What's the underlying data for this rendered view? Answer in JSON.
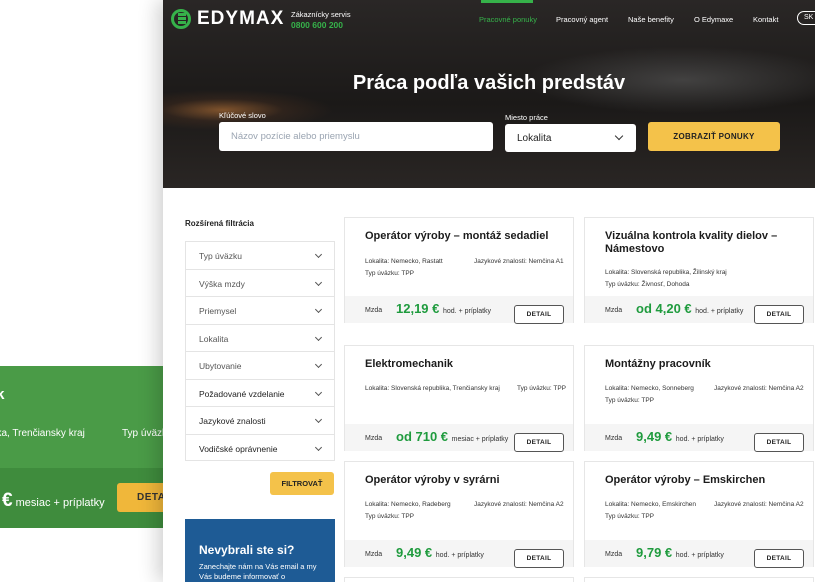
{
  "header": {
    "logo_text": "EDYMAX",
    "service_label": "Zákaznícky servis",
    "service_phone": "0800 600 200",
    "nav": [
      "Pracovné ponuky",
      "Pracovný agent",
      "Naše benefity",
      "O Edymaxe",
      "Kontakt"
    ],
    "lang": "SK",
    "accent_color": "#36b24a"
  },
  "hero": {
    "title": "Práca podľa vašich predstáv",
    "keyword_label": "Kľúčové slovo",
    "keyword_placeholder": "Názov pozície alebo priemyslu",
    "location_label": "Miesto práce",
    "location_value": "Lokalita",
    "search_button": "ZOBRAZIŤ PONUKY"
  },
  "filters": {
    "title": "Rozšírená filtrácia",
    "items": [
      "Typ úväzku",
      "Výška mzdy",
      "Priemysel",
      "Lokalita",
      "Ubytovanie",
      "Požadované vzdelanie",
      "Jazykové znalosti",
      "Vodičské oprávnenie"
    ],
    "button": "FILTROVAŤ"
  },
  "promo": {
    "heading": "Nevybrali ste si?",
    "text": "Zanechajte nám na Vás email a my Vás budeme informovať o"
  },
  "jobs": [
    {
      "title": "Operátor výroby – montáž sedadiel",
      "location": "Lokalita: Nemecko, Rastatt",
      "language": "Jazykové znalosti: Nemčina A1",
      "type": "Typ úväzku: TPP",
      "salary_label": "Mzda",
      "amount": "12,19 €",
      "unit": "hod. + príplatky",
      "detail": "DETAIL"
    },
    {
      "title": "Vizuálna kontrola kvality dielov – Námestovo",
      "location": "Lokalita: Slovenská republika, Žilinský kraj",
      "language": "",
      "type": "Typ úväzku: Živnosť, Dohoda",
      "salary_label": "Mzda",
      "amount": "od 4,20 €",
      "unit": "hod. + príplatky",
      "detail": "DETAIL"
    },
    {
      "title": "Elektromechanik",
      "location": "Lokalita: Slovenská republika, Trenčiansky kraj",
      "language": "Typ úväzku: TPP",
      "type": "",
      "salary_label": "Mzda",
      "amount": "od 710 €",
      "unit": "mesiac + príplatky",
      "detail": "DETAIL"
    },
    {
      "title": "Montážny pracovník",
      "location": "Lokalita: Nemecko, Sonneberg",
      "language": "Jazykové znalosti: Nemčina A2",
      "type": "Typ úväzku: TPP",
      "salary_label": "Mzda",
      "amount": "9,49 €",
      "unit": "hod. + príplatky",
      "detail": "DETAIL"
    },
    {
      "title": "Operátor výroby v syrárni",
      "location": "Lokalita: Nemecko, Radeberg",
      "language": "Jazykové znalosti: Nemčina A2",
      "type": "Typ úväzku: TPP",
      "salary_label": "Mzda",
      "amount": "9,49 €",
      "unit": "hod. + príplatky",
      "detail": "DETAIL"
    },
    {
      "title": "Operátor výroby – Emskirchen",
      "location": "Lokalita: Nemecko, Emskirchen",
      "language": "Jazykové znalosti: Nemčina A2",
      "type": "Typ úväzku: TPP",
      "salary_label": "Mzda",
      "amount": "9,79 €",
      "unit": "hod. + príplatky",
      "detail": "DETAIL"
    }
  ],
  "background_card": {
    "title": "ik",
    "location": "lika, Trenčiansky kraj",
    "type": "Typ úväzk",
    "amount": "€",
    "unit": "mesiac + príplatky",
    "button": "DETA"
  }
}
